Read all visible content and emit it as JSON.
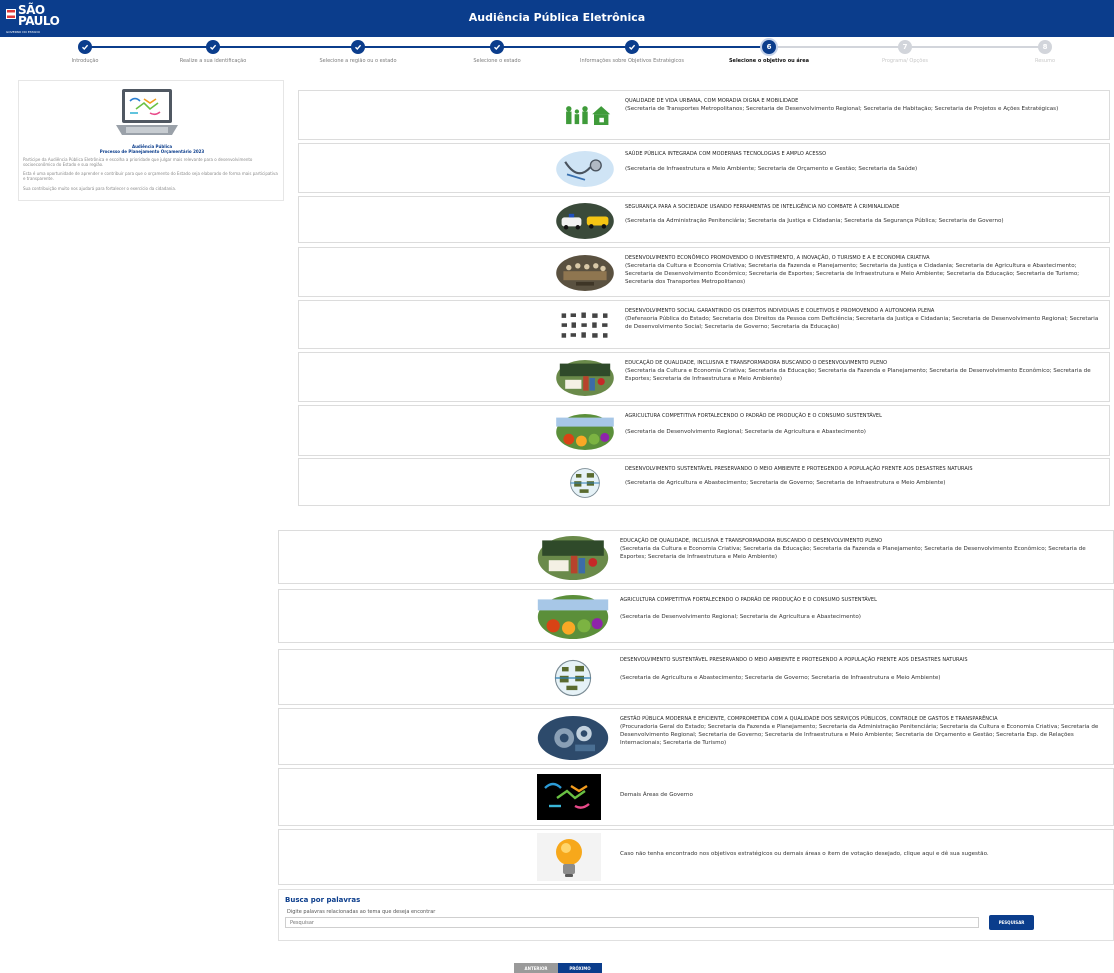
{
  "header": {
    "logo_text": "SÃO PAULO",
    "logo_sub": "GOVERNO DO ESTADO",
    "title": "Audiência Pública Eletrônica"
  },
  "stepper": {
    "steps": [
      {
        "label": "Introdução",
        "state": "done"
      },
      {
        "label": "Realize a sua identificação",
        "state": "done"
      },
      {
        "label": "Selecione a região ou o estado",
        "state": "done"
      },
      {
        "label": "Selecione o estado",
        "state": "done"
      },
      {
        "label": "Informações sobre Objetivos Estratégicos",
        "state": "done"
      },
      {
        "label": "Selecione o objetivo ou área",
        "state": "current"
      },
      {
        "label": "Programa/ Opções",
        "state": "todo"
      },
      {
        "label": "Resumo",
        "state": "todo"
      }
    ]
  },
  "info": {
    "caption_1": "Audiência Pública",
    "caption_2": "Processo de Planejamento Orçamentário 2023",
    "paragraph_1": "Participe da Audiência Pública Eletrônica e escolha a prioridade que julgar mais relevante para o desenvolvimento socioeconômico do Estado e sua região.",
    "paragraph_2": "Esta é uma oportunidade de aprender e contribuir para que o orçamento do Estado seja elaborado de forma mais participativa e transparente.",
    "paragraph_3": "Sua contribuição muito nos ajudará para fortalecer o exercício da cidadania."
  },
  "objectives_top": [
    {
      "title": "QUALIDADE DE VIDA URBANA, COM MORADIA DIGNA E MOBILIDADE",
      "secretarias": "(Secretaria de Transportes Metropolitanos; Secretaria de Desenvolvimento Regional; Secretaria de Habitação; Secretaria de Projetos e Ações Estratégicas)",
      "thumb": "family-house-icon"
    },
    {
      "title": "SAÚDE PÚBLICA INTEGRADA COM MODERNAS TECNOLOGIAS E AMPLO ACESSO",
      "secretarias": "(Secretaria de Infraestrutura e Meio Ambiente; Secretaria de Orçamento e Gestão; Secretaria da Saúde)",
      "thumb": "stethoscope-photo"
    },
    {
      "title": "SEGURANÇA PARA A SOCIEDADE USANDO FERRAMENTAS DE INTELIGÊNCIA NO COMBATE À CRIMINALIDADE",
      "secretarias": "(Secretaria da Administração Penitenciária; Secretaria da Justiça e Cidadania; Secretaria da Segurança Pública; Secretaria de Governo)",
      "thumb": "police-cars-photo"
    },
    {
      "title": "DESENVOLVIMENTO ECONÔMICO PROMOVENDO O INVESTIMENTO, A INOVAÇÃO, O TURISMO E A E ECONOMIA CRIATIVA",
      "secretarias": "(Secretaria da Cultura e Economia Criativa; Secretaria da Fazenda e Planejamento; Secretaria da Justiça e Cidadania; Secretaria de Agricultura e Abastecimento; Secretaria de Desenvolvimento Econômico; Secretaria de Esportes; Secretaria de Infraestrutura e Meio Ambiente; Secretaria da Educação; Secretaria de Turismo; Secretaria dos Transportes Metropolitanos)",
      "thumb": "meeting-photo"
    },
    {
      "title": "DESENVOLVIMENTO SOCIAL GARANTINDO OS DIREITOS INDIVIDUAIS E COLETIVOS E PROMOVENDO A AUTONOMIA PLENA",
      "secretarias": "(Defensoria Pública do Estado; Secretaria dos Direitos da Pessoa com Deficiência; Secretaria da Justiça e Cidadania; Secretaria de Desenvolvimento Regional; Secretaria de Desenvolvimento Social; Secretaria de Governo; Secretaria da Educação)",
      "thumb": "social-icons"
    },
    {
      "title": "EDUCAÇÃO DE QUALIDADE, INCLUSIVA E TRANSFORMADORA BUSCANDO O DESENVOLVIMENTO PLENO",
      "secretarias": "(Secretaria da Cultura e Economia Criativa; Secretaria da Educação; Secretaria da Fazenda e Planejamento; Secretaria de Desenvolvimento Econômico; Secretaria de Esportes; Secretaria de Infraestrutura e Meio Ambiente)",
      "thumb": "books-photo"
    },
    {
      "title": "AGRICULTURA COMPETITIVA FORTALECENDO O PADRÃO DE PRODUÇÃO E O CONSUMO SUSTENTÁVEL",
      "secretarias": "(Secretaria de Desenvolvimento Regional; Secretaria de Agricultura e Abastecimento)",
      "thumb": "produce-photo"
    },
    {
      "title": "DESENVOLVIMENTO SUSTENTÁVEL PRESERVANDO O MEIO AMBIENTE E PROTEGENDO A POPULAÇÃO FRENTE AOS DESASTRES NATURAIS",
      "secretarias": "(Secretaria de Agricultura e Abastecimento; Secretaria de Governo; Secretaria de Infraestrutura e Meio Ambiente)",
      "thumb": "globe-icon"
    }
  ],
  "objectives_bottom": [
    {
      "title": "EDUCAÇÃO DE QUALIDADE, INCLUSIVA E TRANSFORMADORA BUSCANDO O DESENVOLVIMENTO PLENO",
      "secretarias": "(Secretaria da Cultura e Economia Criativa; Secretaria da Educação; Secretaria da Fazenda e Planejamento; Secretaria de Desenvolvimento Econômico; Secretaria de Esportes; Secretaria de Infraestrutura e Meio Ambiente)",
      "thumb": "books-photo"
    },
    {
      "title": "AGRICULTURA COMPETITIVA FORTALECENDO O PADRÃO DE PRODUÇÃO E O CONSUMO SUSTENTÁVEL",
      "secretarias": "(Secretaria de Desenvolvimento Regional; Secretaria de Agricultura e Abastecimento)",
      "thumb": "produce-photo"
    },
    {
      "title": "DESENVOLVIMENTO SUSTENTÁVEL PRESERVANDO O MEIO AMBIENTE E PROTEGENDO A POPULAÇÃO FRENTE AOS DESASTRES NATURAIS",
      "secretarias": "(Secretaria de Agricultura e Abastecimento; Secretaria de Governo; Secretaria de Infraestrutura e Meio Ambiente)",
      "thumb": "globe-icon"
    },
    {
      "title": "GESTÃO PÚBLICA MODERNA E EFICIENTE, COMPROMETIDA COM A QUALIDADE DOS SERVIÇOS PÚBLICOS, CONTROLE DE GASTOS E TRANSPARÊNCIA",
      "secretarias": "(Procuradoria Geral do Estado; Secretaria da Fazenda e Planejamento; Secretaria da Administração Penitenciária; Secretaria da Cultura e Economia Criativa; Secretaria de Desenvolvimento Regional; Secretaria de Governo; Secretaria de Infraestrutura e Meio Ambiente; Secretaria de Orçamento e Gestão; Secretaria Esp. de Relações Internacionais; Secretaria de Turismo)",
      "thumb": "gears-photo"
    }
  ],
  "other_areas": {
    "label": "Demais Áreas de Governo"
  },
  "suggestion": {
    "label": "Caso não tenha encontrado nos objetivos estratégicos ou demais áreas o item de votação desejado, clique aqui e dê sua sugestão."
  },
  "search": {
    "heading": "Busca por palavras",
    "hint": "Digite palavras relacionadas ao tema que deseja encontrar",
    "placeholder": "Pesquisar",
    "button": "PESQUISAR"
  },
  "nav": {
    "prev": "ANTERIOR",
    "next": "PRÓXIMO"
  },
  "colors": {
    "primary": "#0b3d8c",
    "step_todo": "#d2d5db",
    "prev_button": "#9a9a9a"
  }
}
